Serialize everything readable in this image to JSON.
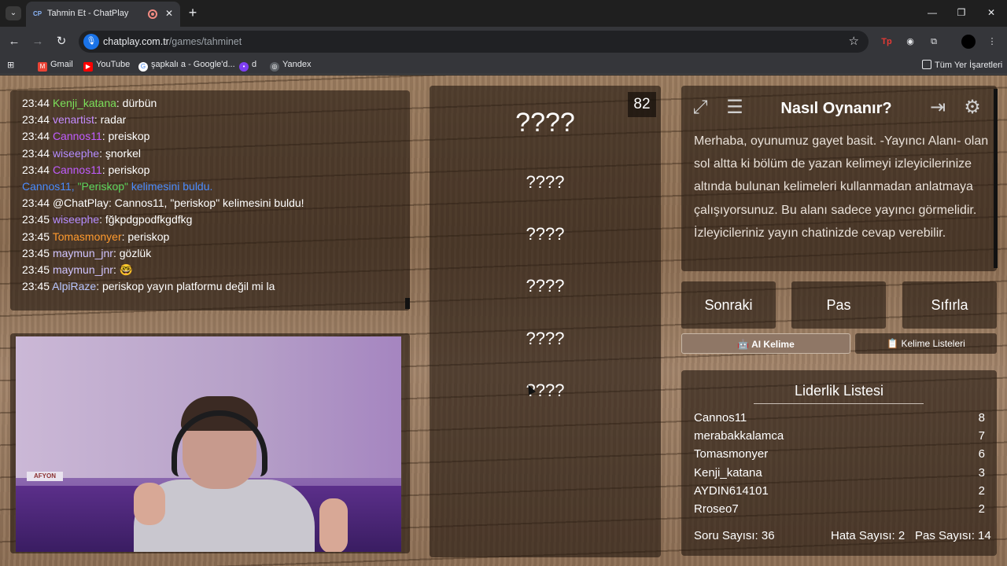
{
  "browser": {
    "tab_title": "Tahmin Et - ChatPlay",
    "tab_favicon": "CP",
    "url_host": "chatplay.com.tr",
    "url_path": "/games/tahminet",
    "bookmarks": [
      "Gmail",
      "YouTube",
      "şapkalı a - Google'd...",
      "d",
      "Yandex"
    ],
    "all_bookmarks": "Tüm Yer İşaretleri"
  },
  "chat": {
    "messages": [
      {
        "time": "23:44",
        "user": "Kenji_katana",
        "color": "#7be05a",
        "text": ": dürbün"
      },
      {
        "time": "23:44",
        "user": "venartist",
        "color": "#c58cff",
        "text": ": radar"
      },
      {
        "time": "23:44",
        "user": "Cannos11",
        "color": "#c05cff",
        "text": ": preiskop"
      },
      {
        "time": "23:44",
        "user": "wiseephe",
        "color": "#b48cff",
        "text": ": şnorkel"
      },
      {
        "time": "23:44",
        "user": "Cannos11",
        "color": "#c05cff",
        "text": ": periskop"
      },
      {
        "system": "Cannos11, \"Periskop\" kelimesini buldu."
      },
      {
        "time": "23:44",
        "user": "@ChatPlay",
        "color": "#ffffff",
        "text": ": Cannos11, \"periskop\" kelimesini buldu!"
      },
      {
        "time": "23:45",
        "user": "wiseephe",
        "color": "#b48cff",
        "text": ": fğkpdgpodfkgdfkg"
      },
      {
        "time": "23:45",
        "user": "Tomasmonyer",
        "color": "#ff9a2e",
        "text": ": periskop"
      },
      {
        "time": "23:45",
        "user": "maymun_jnr",
        "color": "#d0c4ff",
        "text": ": gözlük"
      },
      {
        "time": "23:45",
        "user": "maymun_jnr",
        "color": "#d0c4ff",
        "text": ": 🤓"
      },
      {
        "time": "23:45",
        "user": "AlpiRaze",
        "color": "#b8c6ff",
        "text": ": periskop yayın platformu değil mi la"
      }
    ]
  },
  "game": {
    "timer": "82",
    "main_word": "????",
    "taboo_words": [
      "????",
      "????",
      "????",
      "????",
      "????"
    ]
  },
  "howto": {
    "title": "Nasıl Oynanır?",
    "text": "Merhaba, oyunumuz gayet basit. -Yayıncı Alanı- olan sol altta ki bölüm de yazan kelimeyi izleyicilerinize altında bulunan kelimeleri kullanmadan anlatmaya çalışıyorsunuz. Bu alanı sadece yayıncı görmelidir. İzleyicileriniz yayın chatinizde cevap verebilir."
  },
  "actions": {
    "next": "Sonraki",
    "pass": "Pas",
    "reset": "Sıfırla",
    "ai_word": "🤖 AI Kelime",
    "word_lists": "📋 Kelime Listeleri"
  },
  "leaderboard": {
    "title": "Liderlik Listesi",
    "rows": [
      {
        "name": "Cannos11",
        "score": "8"
      },
      {
        "name": "merabakkalamca",
        "score": "7"
      },
      {
        "name": "Tomasmonyer",
        "score": "6"
      },
      {
        "name": "Kenji_katana",
        "score": "3"
      },
      {
        "name": "AYDIN614101",
        "score": "2"
      },
      {
        "name": "Rroseo7",
        "score": "2"
      }
    ],
    "question_count": "Soru Sayısı: 36",
    "error_count": "Hata Sayısı: 2",
    "pass_count": "Pas Sayısı: 14"
  },
  "colors": {
    "board_bg": "#231810",
    "system_user": "#4a8cff",
    "system_word": "#5cd65c"
  },
  "icons": [
    "fullscreen-icon",
    "notes-icon",
    "exit-icon",
    "settings-icon"
  ]
}
